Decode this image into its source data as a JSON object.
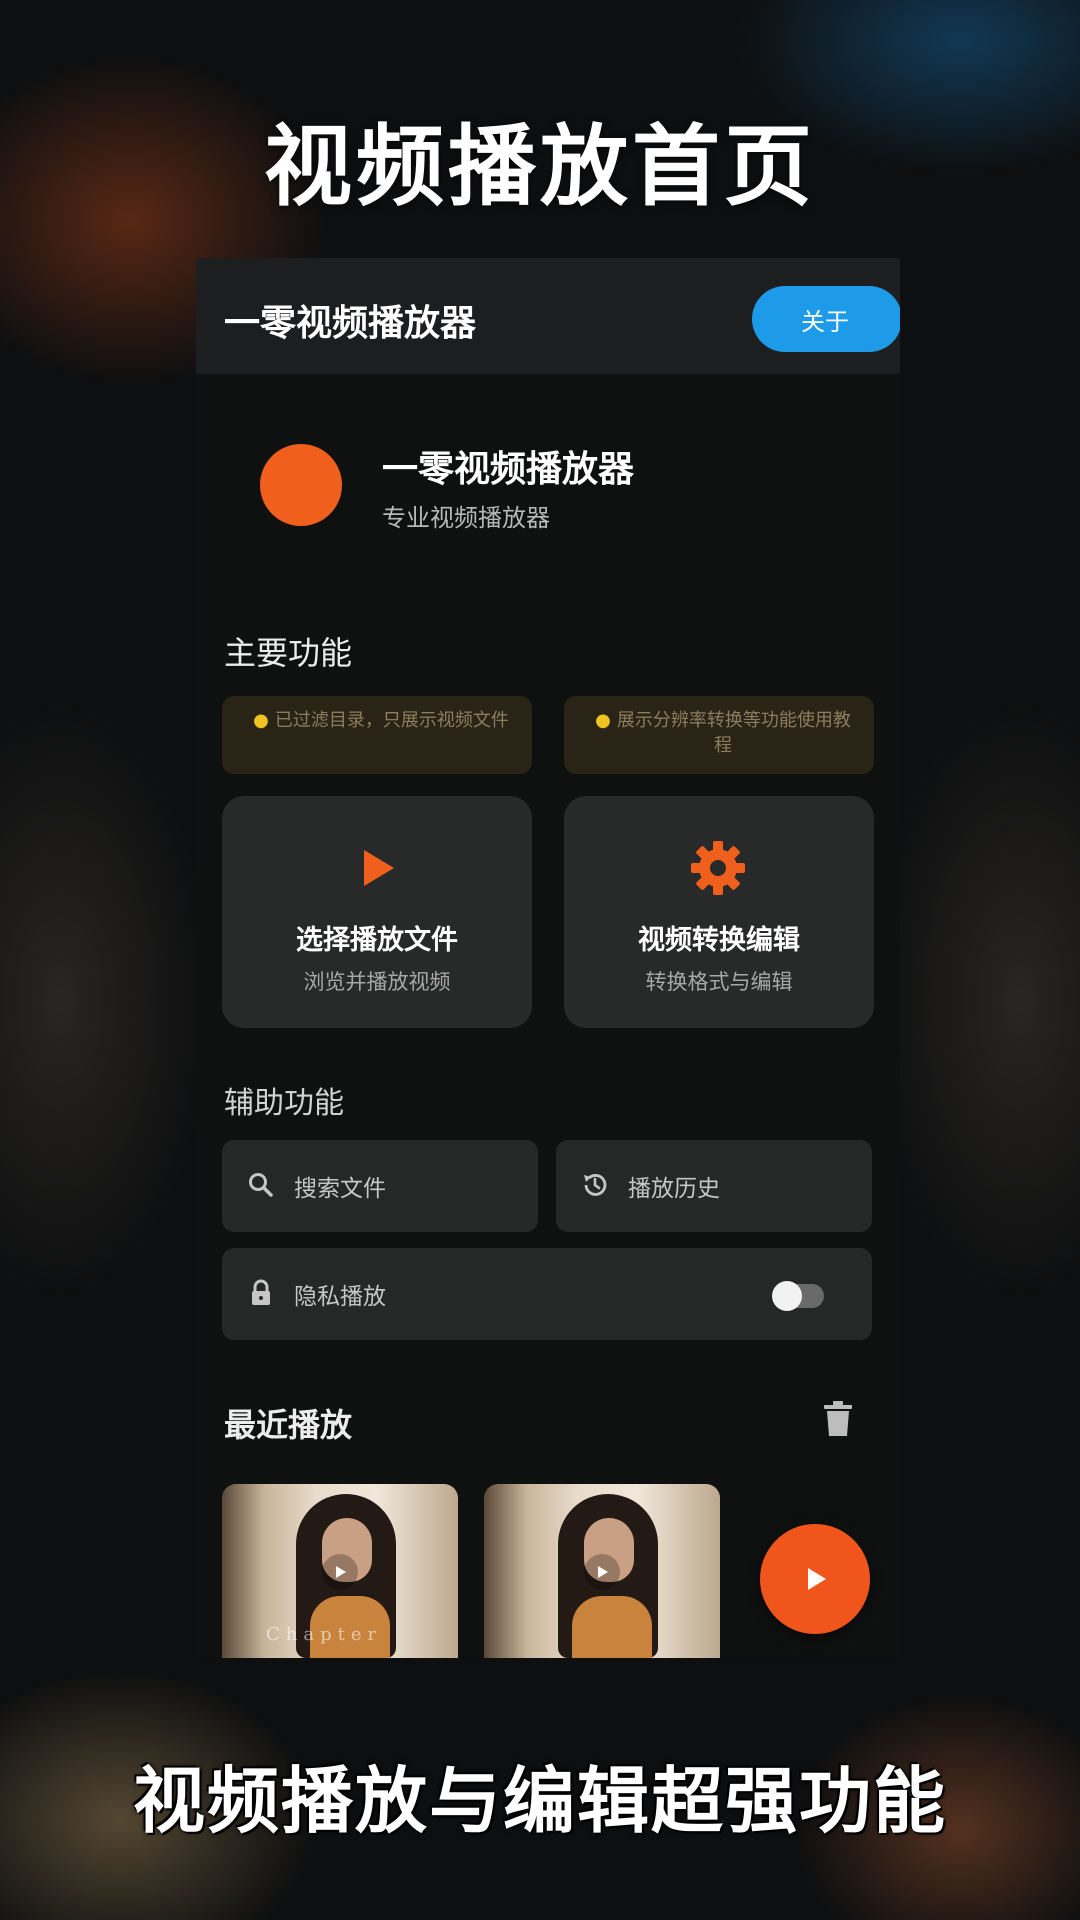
{
  "overlay": {
    "headline": "视频播放首页",
    "caption": "视频播放与编辑超强功能"
  },
  "appbar": {
    "title": "一零视频播放器",
    "about_button": "关于"
  },
  "app_header": {
    "name": "一零视频播放器",
    "subtitle": "专业视频播放器"
  },
  "main_section": {
    "title": "主要功能",
    "tips": [
      {
        "icon": "lightbulb-icon",
        "text": "已过滤目录，只展示视频文件"
      },
      {
        "icon": "lightbulb-icon",
        "text": "展示分辨率转换等功能使用教程"
      }
    ],
    "features": [
      {
        "icon": "play-icon",
        "title": "选择播放文件",
        "subtitle": "浏览并播放视频"
      },
      {
        "icon": "gear-icon",
        "title": "视频转换编辑",
        "subtitle": "转换格式与编辑"
      }
    ]
  },
  "aux_section": {
    "title": "辅助功能",
    "search": {
      "icon": "search-icon",
      "label": "搜索文件"
    },
    "history": {
      "icon": "history-icon",
      "label": "播放历史"
    },
    "privacy": {
      "icon": "lock-icon",
      "label": "隐私播放",
      "toggle_on": false
    }
  },
  "recent_section": {
    "title": "最近播放",
    "clear_icon": "trash-icon",
    "thumbnails": [
      {
        "caption": "Chapter"
      },
      {
        "caption": ""
      }
    ]
  },
  "fab": {
    "icon": "play-icon"
  },
  "colors": {
    "accent_orange": "#f0601c",
    "about_blue": "#1e9be8",
    "card_bg": "#282929",
    "tip_bg": "#2a2416"
  }
}
